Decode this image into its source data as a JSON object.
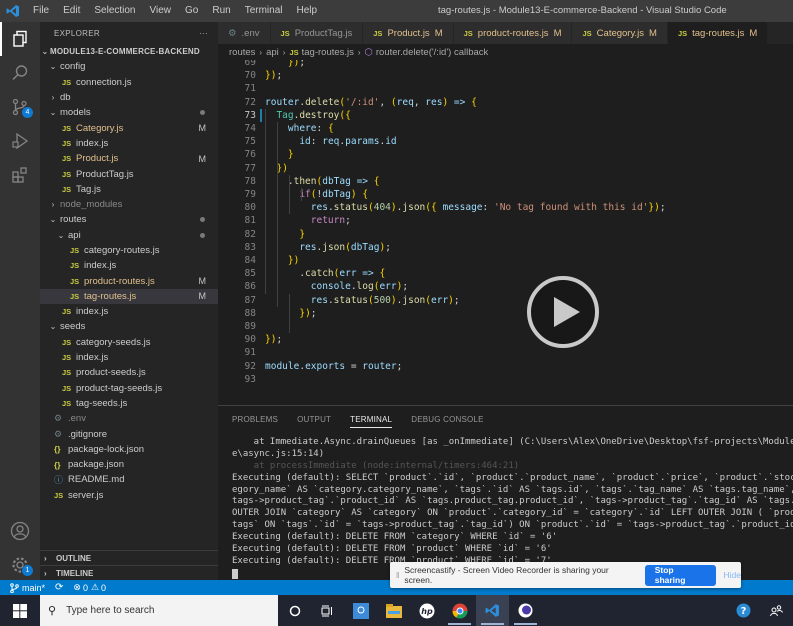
{
  "window": {
    "title": "tag-routes.js - Module13-E-commerce-Backend - Visual Studio Code",
    "menu": [
      "File",
      "Edit",
      "Selection",
      "View",
      "Go",
      "Run",
      "Terminal",
      "Help"
    ]
  },
  "activity_bar": {
    "items": [
      {
        "name": "explorer",
        "icon": "files-icon",
        "active": true
      },
      {
        "name": "search",
        "icon": "search-icon"
      },
      {
        "name": "source-control",
        "icon": "source-control-icon",
        "badge": "4"
      },
      {
        "name": "run-debug",
        "icon": "run-debug-icon"
      },
      {
        "name": "extensions",
        "icon": "extensions-icon"
      }
    ],
    "bottom": [
      {
        "name": "accounts",
        "icon": "account-icon"
      },
      {
        "name": "manage",
        "icon": "gear-icon",
        "badge": "1"
      }
    ]
  },
  "sidebar": {
    "header": "EXPLORER",
    "more": "···",
    "project": "MODULE13-E-COMMERCE-BACKEND",
    "tree": [
      {
        "label": "config",
        "type": "folder",
        "open": true,
        "depth": 1
      },
      {
        "label": "connection.js",
        "type": "js",
        "depth": 2
      },
      {
        "label": "db",
        "type": "folder",
        "open": false,
        "depth": 1
      },
      {
        "label": "models",
        "type": "folder",
        "open": true,
        "depth": 1,
        "dot": true
      },
      {
        "label": "Category.js",
        "type": "js",
        "depth": 2,
        "status": "M"
      },
      {
        "label": "index.js",
        "type": "js",
        "depth": 2
      },
      {
        "label": "Product.js",
        "type": "js",
        "depth": 2,
        "status": "M"
      },
      {
        "label": "ProductTag.js",
        "type": "js",
        "depth": 2
      },
      {
        "label": "Tag.js",
        "type": "js",
        "depth": 2
      },
      {
        "label": "node_modules",
        "type": "folder",
        "open": false,
        "depth": 1,
        "dim": true
      },
      {
        "label": "routes",
        "type": "folder",
        "open": true,
        "depth": 1,
        "dot": true
      },
      {
        "label": "api",
        "type": "folder",
        "open": true,
        "depth": 2,
        "dot": true
      },
      {
        "label": "category-routes.js",
        "type": "js",
        "depth": 3
      },
      {
        "label": "index.js",
        "type": "js",
        "depth": 3
      },
      {
        "label": "product-routes.js",
        "type": "js",
        "depth": 3,
        "status": "M"
      },
      {
        "label": "tag-routes.js",
        "type": "js",
        "depth": 3,
        "status": "M",
        "selected": true
      },
      {
        "label": "index.js",
        "type": "js",
        "depth": 2
      },
      {
        "label": "seeds",
        "type": "folder",
        "open": true,
        "depth": 1
      },
      {
        "label": "category-seeds.js",
        "type": "js",
        "depth": 2
      },
      {
        "label": "index.js",
        "type": "js",
        "depth": 2
      },
      {
        "label": "product-seeds.js",
        "type": "js",
        "depth": 2
      },
      {
        "label": "product-tag-seeds.js",
        "type": "js",
        "depth": 2
      },
      {
        "label": "tag-seeds.js",
        "type": "js",
        "depth": 2
      },
      {
        "label": ".env",
        "type": "gear",
        "depth": 1,
        "dim": true
      },
      {
        "label": ".gitignore",
        "type": "gear",
        "depth": 1
      },
      {
        "label": "package-lock.json",
        "type": "json",
        "depth": 1
      },
      {
        "label": "package.json",
        "type": "json",
        "depth": 1
      },
      {
        "label": "README.md",
        "type": "info",
        "depth": 1
      },
      {
        "label": "server.js",
        "type": "js",
        "depth": 1
      }
    ],
    "sections": [
      "OUTLINE",
      "TIMELINE"
    ]
  },
  "tabs": [
    {
      "label": ".env",
      "icon": "gear",
      "status": ""
    },
    {
      "label": "ProductTag.js",
      "icon": "js",
      "status": ""
    },
    {
      "label": "Product.js",
      "icon": "js",
      "status": "M"
    },
    {
      "label": "product-routes.js",
      "icon": "js",
      "status": "M"
    },
    {
      "label": "Category.js",
      "icon": "js",
      "status": "M"
    },
    {
      "label": "tag-routes.js",
      "icon": "js",
      "status": "M",
      "active": true
    }
  ],
  "breadcrumb": {
    "parts": [
      "routes",
      "api",
      "tag-routes.js",
      "router.delete('/:id') callback"
    ]
  },
  "editor": {
    "current_line": 73,
    "lines": [
      {
        "n": "69",
        "html": "    });"
      },
      {
        "n": "70",
        "html": "});"
      },
      {
        "n": "71",
        "html": ""
      },
      {
        "n": "72",
        "html": "router.delete('/:id', (req, res) => {"
      },
      {
        "n": "73",
        "html": "  Tag.destroy({"
      },
      {
        "n": "74",
        "html": "    where: {"
      },
      {
        "n": "75",
        "html": "      id: req.params.id"
      },
      {
        "n": "76",
        "html": "    }"
      },
      {
        "n": "77",
        "html": "  })"
      },
      {
        "n": "78",
        "html": "    .then(dbTag => {"
      },
      {
        "n": "79",
        "html": "      if(!dbTag) {"
      },
      {
        "n": "80",
        "html": "        res.status(404).json({ message: 'No tag found with this id'});"
      },
      {
        "n": "81",
        "html": "        return;"
      },
      {
        "n": "82",
        "html": "      }"
      },
      {
        "n": "83",
        "html": "      res.json(dbTag);"
      },
      {
        "n": "84",
        "html": "    })"
      },
      {
        "n": "85",
        "html": "      .catch(err => {"
      },
      {
        "n": "86",
        "html": "        console.log(err);"
      },
      {
        "n": "87",
        "html": "        res.status(500).json(err);"
      },
      {
        "n": "88",
        "html": "      });"
      },
      {
        "n": "89",
        "html": ""
      },
      {
        "n": "90",
        "html": "});"
      },
      {
        "n": "91",
        "html": ""
      },
      {
        "n": "92",
        "html": "module.exports = router;"
      },
      {
        "n": "93",
        "html": ""
      }
    ]
  },
  "panel": {
    "tabs": [
      "PROBLEMS",
      "OUTPUT",
      "TERMINAL",
      "DEBUG CONSOLE"
    ],
    "active_tab": "TERMINAL",
    "terminal_lines": [
      {
        "text": "    at Immediate.Async.drainQueues [as _onImmediate] (C:\\Users\\Alex\\OneDrive\\Desktop\\fsf-projects\\Module13"
      },
      {
        "text": "e\\async.js:15:14)"
      },
      {
        "text": "    at processImmediate (node:internal/timers:464:21)",
        "faded": true
      },
      {
        "text": "Executing (default): SELECT `product`.`id`, `product`.`product_name`, `product`.`price`, `product`.`stock"
      },
      {
        "text": "egory_name` AS `category.category_name`, `tags`.`id` AS `tags.id`, `tags`.`tag_name` AS `tags.tag_name`,"
      },
      {
        "text": "tags->product_tag`.`product_id` AS `tags.product_tag.product_id`, `tags->product_tag`.`tag_id` AS `tags.p"
      },
      {
        "text": "OUTER JOIN `category` AS `category` ON `product`.`category_id` = `category`.`id` LEFT OUTER JOIN ( `produ"
      },
      {
        "text": "tags` ON `tags`.`id` = `tags->product_tag`.`tag_id`) ON `product`.`id` = `tags->product_tag`.`product_id"
      },
      {
        "text": "Executing (default): DELETE FROM `category` WHERE `id` = '6'"
      },
      {
        "text": "Executing (default): DELETE FROM `product` WHERE `id` = '6'"
      },
      {
        "text": "Executing (default): DELETE FROM `product` WHERE `id` = '7'"
      }
    ]
  },
  "screencast_bar": {
    "message": "Screencastify - Screen Video Recorder is sharing your screen.",
    "stop_label": "Stop sharing",
    "hide_label": "Hide"
  },
  "statusbar": {
    "branch": "main*",
    "errors": "0",
    "warnings": "0"
  },
  "taskbar": {
    "search_placeholder": "Type here to search",
    "apps": [
      "cortana",
      "task-view",
      "app-store-helper",
      "file-explorer",
      "hp",
      "chrome",
      "vscode",
      "screencastify"
    ]
  },
  "colors": {
    "accent": "#007acc",
    "modified": "#e2c08d",
    "stop_button": "#1a73e8"
  }
}
